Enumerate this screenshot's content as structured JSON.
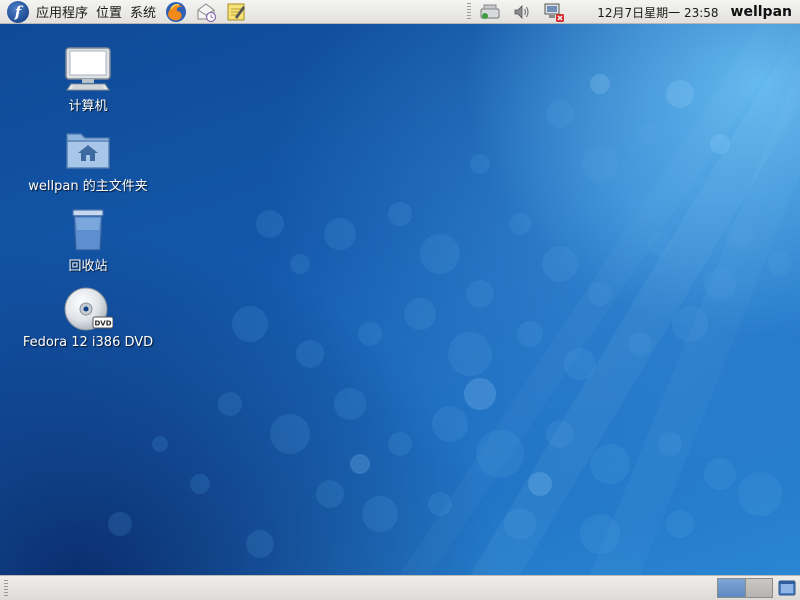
{
  "top_panel": {
    "menus": [
      "应用程序",
      "位置",
      "系统"
    ],
    "launchers": [
      "firefox-icon",
      "evolution-mail-icon",
      "notes-editor-icon"
    ],
    "tray_icons": [
      "network-manager-icon",
      "volume-icon",
      "network-disconnected-icon"
    ],
    "clock": "12月7日星期一 23:58",
    "username": "wellpan"
  },
  "desktop": {
    "icons": [
      {
        "name": "computer-icon",
        "label": "计算机"
      },
      {
        "name": "home-folder-icon",
        "label": "wellpan 的主文件夹"
      },
      {
        "name": "trash-icon",
        "label": "回收站"
      },
      {
        "name": "dvd-icon",
        "label": "Fedora 12 i386 DVD"
      }
    ]
  },
  "bottom_panel": {
    "workspaces": [
      {
        "name": "workspace-1",
        "active": true
      },
      {
        "name": "workspace-2",
        "active": false
      }
    ]
  },
  "colors": {
    "panel_bg": "#e8e7e4",
    "wallpaper_dark": "#0e3f86",
    "wallpaper_light": "#2a86d2",
    "fedora_blue": "#294172"
  }
}
